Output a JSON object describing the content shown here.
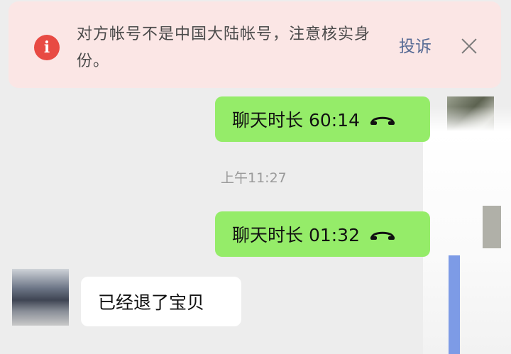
{
  "banner": {
    "warning_text": "对方帐号不是中国大陆帐号，注意核实身份。",
    "report_label": "投诉",
    "close_icon": "close-icon",
    "alert_icon": "exclamation-circle-icon",
    "alert_glyph": "i"
  },
  "messages": [
    {
      "side": "out",
      "type": "call",
      "label": "聊天时长 60:14",
      "icon": "phone-hangup-icon"
    },
    {
      "side": "system",
      "type": "timestamp",
      "label": "上午11:27"
    },
    {
      "side": "out",
      "type": "call",
      "label": "聊天时长 01:32",
      "icon": "phone-hangup-icon"
    },
    {
      "side": "in",
      "type": "text",
      "label": "已经退了宝贝"
    }
  ],
  "colors": {
    "outgoing_bubble": "#95ec69",
    "incoming_bubble": "#ffffff",
    "banner_bg": "#fbe6e5",
    "alert_red": "#e84a43",
    "link_blue": "#576b95"
  }
}
